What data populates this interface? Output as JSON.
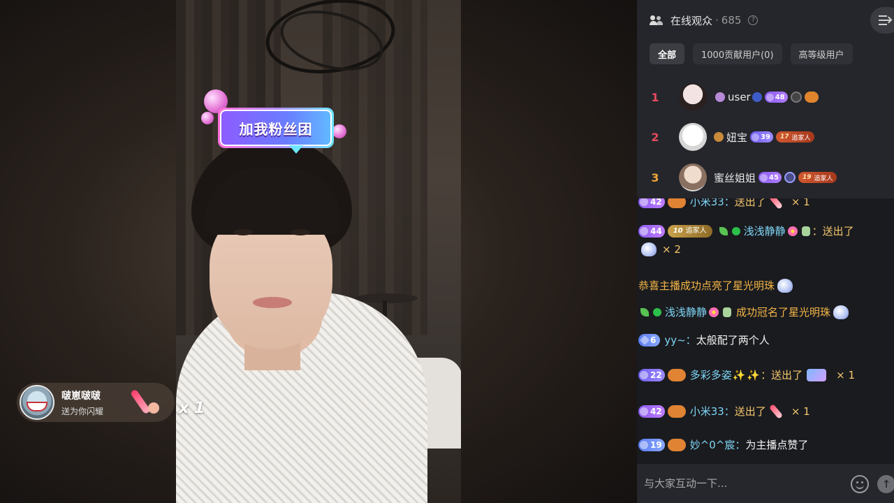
{
  "fan_badge": {
    "label": "加我粉丝团"
  },
  "gift_popup": {
    "name": "啵崽啵啵",
    "desc": "送为你闪耀",
    "count": "x 1"
  },
  "viewers": {
    "title": "在线观众",
    "separator": "·",
    "count": "685",
    "tabs": [
      "全部",
      "1000贡献用户(0)",
      "高等级用户"
    ],
    "ranking": [
      {
        "rank": "1",
        "name": "user",
        "level": "48",
        "rank_color": "#e84a5f"
      },
      {
        "rank": "2",
        "name": "妞宝",
        "level": "39",
        "fan_level": "17",
        "fan_label": "追家人",
        "rank_color": "#e84a5f"
      },
      {
        "rank": "3",
        "name": "蜜丝姐姐",
        "level": "45",
        "fan_level": "19",
        "fan_label": "追家人",
        "rank_color": "#f0a43a"
      }
    ]
  },
  "chat": {
    "messages": [
      {
        "level": "42",
        "user": "小米33：",
        "action": "送出了",
        "qty": "× 1"
      },
      {
        "level": "44",
        "fan_level": "10",
        "fan_label": "追家人",
        "user": "浅浅静静",
        "action": "：送出了",
        "qty": "× 2"
      },
      {
        "notice": "恭喜主播成功点亮了星光明珠"
      },
      {
        "user": "浅浅静静",
        "action": "成功冠名了星光明珠"
      },
      {
        "level": "6",
        "user": "yy~：",
        "text": "太般配了两个人"
      },
      {
        "level": "22",
        "user": "多彩多姿",
        "sparkle": "✨",
        "action": "：送出了",
        "qty": "× 1"
      },
      {
        "level": "42",
        "user": "小米33：",
        "action": "送出了",
        "qty": "× 1"
      },
      {
        "level": "19",
        "user": "妙^0^宸：",
        "text": "为主播点赞了"
      }
    ]
  },
  "input": {
    "placeholder": "与大家互动一下..."
  },
  "colors": {
    "panel_bg": "#1a1b1f",
    "username": "#7fd6f6",
    "gift_text": "#f5c76c",
    "notice": "#f3b546"
  }
}
